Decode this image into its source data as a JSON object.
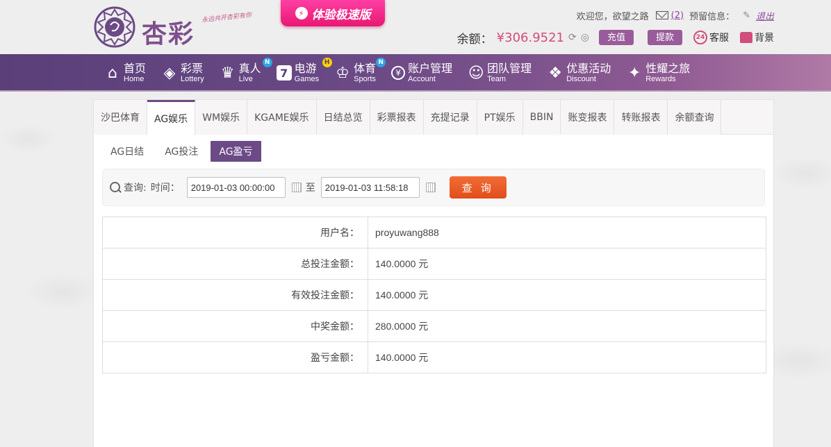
{
  "header": {
    "logo_text": "杏彩",
    "logo_slogan": "永远共开杏彩有你",
    "promo_label": "体验极速版",
    "greeting": "欢迎您，欲望之路",
    "mail_count": "(2)",
    "reserve_label": "预留信息：",
    "logout_label": "退出",
    "balance_label": "余额：",
    "balance_value": "¥306.9521",
    "recharge_label": "充值",
    "withdraw_label": "提款",
    "service_label": "客服",
    "service_badge": "24",
    "background_label": "背景"
  },
  "nav": [
    {
      "cn": "首页",
      "en": "Home",
      "icon": "home-icon"
    },
    {
      "cn": "彩票",
      "en": "Lottery",
      "icon": "lottery-icon"
    },
    {
      "cn": "真人",
      "en": "Live",
      "icon": "live-icon",
      "badge": "N"
    },
    {
      "cn": "电游",
      "en": "Games",
      "icon": "games-icon",
      "badge": "H"
    },
    {
      "cn": "体育",
      "en": "Sports",
      "icon": "trophy-icon",
      "badge": "N"
    },
    {
      "cn": "账户管理",
      "en": "Account",
      "icon": "account-icon"
    },
    {
      "cn": "团队管理",
      "en": "Team",
      "icon": "team-icon"
    },
    {
      "cn": "优惠活动",
      "en": "Discount",
      "icon": "gift-icon"
    },
    {
      "cn": "性耀之旅",
      "en": "Rewards",
      "icon": "rewards-icon"
    }
  ],
  "tabs": [
    "沙巴体育",
    "AG娱乐",
    "WM娱乐",
    "KGAME娱乐",
    "日结总览",
    "彩票报表",
    "充提记录",
    "PT娱乐",
    "BBIN",
    "账变报表",
    "转账报表",
    "余额查询"
  ],
  "active_tab": 1,
  "subtabs": [
    "AG日结",
    "AG投注",
    "AG盈亏"
  ],
  "active_subtab": 2,
  "query": {
    "query_label": "查询:",
    "time_label": "时间：",
    "start": "2019-01-03 00:00:00",
    "to_label": "至",
    "end": "2019-01-03 11:58:18",
    "button": "查 询"
  },
  "results": [
    {
      "label": "用户名：",
      "value": "proyuwang888"
    },
    {
      "label": "总投注金额：",
      "value": "140.0000 元"
    },
    {
      "label": "有效投注金额：",
      "value": "140.0000 元"
    },
    {
      "label": "中奖金额：",
      "value": "280.0000 元"
    },
    {
      "label": "盈亏金额：",
      "value": "140.0000 元"
    }
  ],
  "colors": {
    "accent": "#6b4a86",
    "query_button": "#e85a27",
    "balance": "#d14d7b"
  }
}
